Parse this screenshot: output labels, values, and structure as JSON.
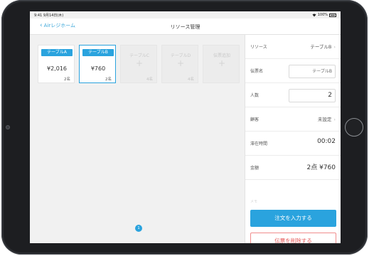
{
  "status_bar": {
    "time": "9:41 9月14日(木)",
    "battery": "100%"
  },
  "nav": {
    "back_label": "Airレジホーム",
    "title": "リソース管理"
  },
  "tables": [
    {
      "label": "テーブルA",
      "amount": "¥2,016",
      "count": "2名",
      "selected": false
    },
    {
      "label": "テーブルB",
      "amount": "¥760",
      "count": "2名",
      "selected": true
    }
  ],
  "empty_tables": [
    {
      "label": "テーブルC",
      "count": "4名"
    },
    {
      "label": "テーブルD",
      "count": "4名"
    },
    {
      "label": "伝票追加",
      "count": ""
    }
  ],
  "page_indicator": "1",
  "panel": {
    "resource": {
      "label": "リソース",
      "value": "テーブルB"
    },
    "slip_name": {
      "label": "伝票名",
      "value": "テーブルB"
    },
    "people": {
      "label": "人数",
      "value": "2"
    },
    "customer": {
      "label": "顧客",
      "value": "未設定"
    },
    "stay_time": {
      "label": "滞在時間",
      "value": "00:02"
    },
    "amount": {
      "label": "金額",
      "value": "2点 ¥760"
    },
    "faded_label": "メモ",
    "primary_button": "注文を入力する",
    "danger_button": "伝票を削除する"
  }
}
